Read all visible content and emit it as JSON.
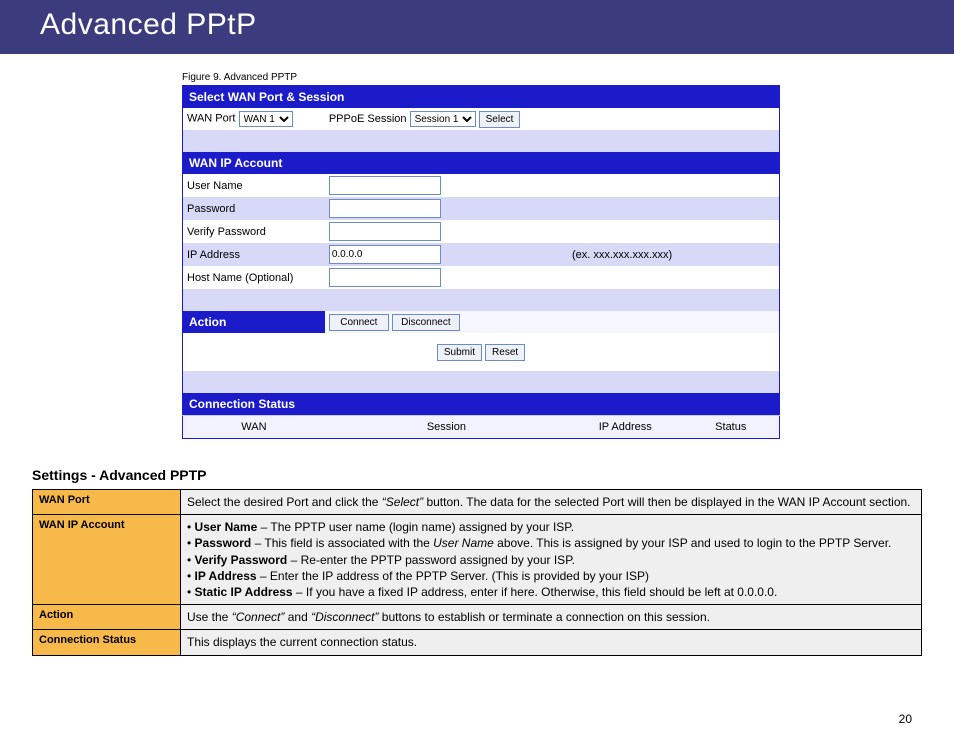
{
  "title": "Advanced PPtP",
  "figure_caption": "Figure 9. Advanced PPTP",
  "sections": {
    "select_wan": "Select WAN Port & Session",
    "wan_ip": "WAN IP Account",
    "action": "Action",
    "conn_status": "Connection Status"
  },
  "labels": {
    "wan_port": "WAN Port",
    "pppoe_session": "PPPoE Session",
    "user_name": "User Name",
    "password": "Password",
    "verify_password": "Verify Password",
    "ip_address": "IP Address",
    "ip_hint": "(ex. xxx.xxx.xxx.xxx)",
    "host_name": "Host Name (Optional)"
  },
  "values": {
    "wan_port": "WAN 1",
    "session": "Session 1",
    "ip_address": "0.0.0.0"
  },
  "buttons": {
    "select": "Select",
    "connect": "Connect",
    "disconnect": "Disconnect",
    "submit": "Submit",
    "reset": "Reset"
  },
  "status_cols": {
    "wan": "WAN",
    "session": "Session",
    "ip": "IP Address",
    "status": "Status"
  },
  "help": {
    "title": "Settings - Advanced PPTP",
    "rows": [
      {
        "label": "WAN Port",
        "html": "Select the desired Port and click the <span class=\"i\">“Select”</span> button. The data for the selected Port will then be displayed in the WAN IP Account section."
      },
      {
        "label": "WAN IP Account",
        "html": "• <span class=\"b\">User Name</span> – The PPTP user name (login name) assigned by your ISP.<br>• <span class=\"b\">Password</span> – This field is associated with the <span class=\"i\">User Name</span> above. This is assigned by your ISP and used to login to the PPTP Server.<br>• <span class=\"b\">Verify Password</span> – Re-enter the PPTP password assigned by your ISP.<br>• <span class=\"b\">IP Address</span> – Enter the IP address of the PPTP Server. (This is provided by your ISP)<br>• <span class=\"b\">Static IP Address</span> – If you have a fixed IP address, enter if here. Otherwise, this field should be left at 0.0.0.0."
      },
      {
        "label": "Action",
        "html": "Use the <span class=\"i\">“Connect”</span> and <span class=\"i\">“Disconnect”</span> buttons to establish or terminate a connection on this session."
      },
      {
        "label": "Connection Status",
        "html": "This displays the current connection status."
      }
    ]
  },
  "page_number": "20"
}
